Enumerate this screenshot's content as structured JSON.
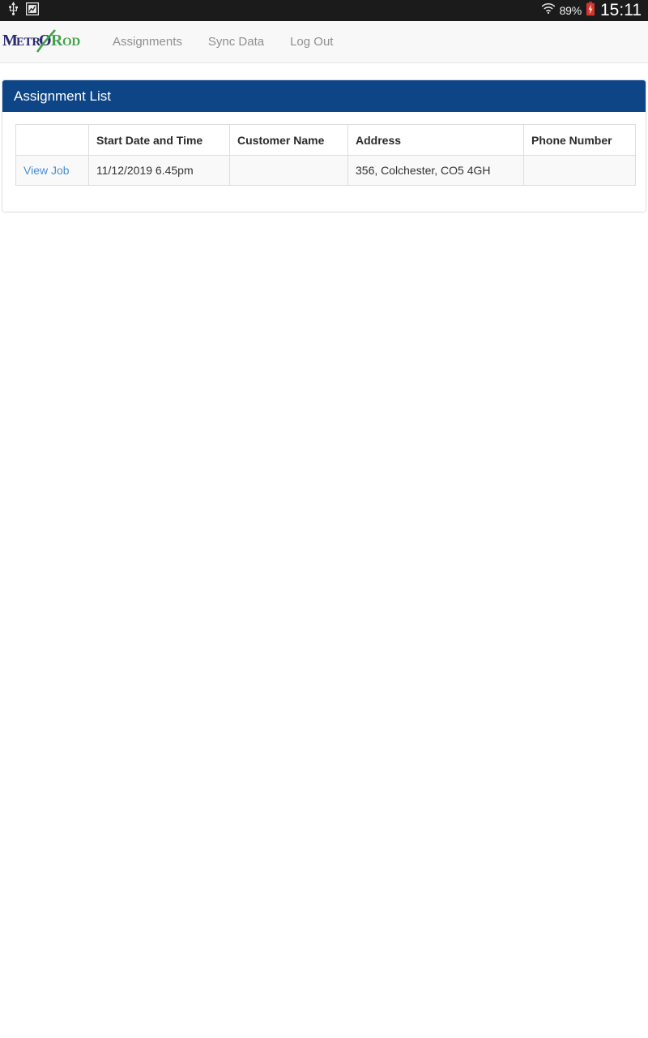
{
  "status_bar": {
    "left_icons": [
      "usb-icon",
      "screenshot-icon"
    ],
    "wifi_icon": "wifi-icon",
    "battery_percent": "89%",
    "battery_icon": "battery-charging-icon",
    "battery_color": "#d9342b",
    "time": "15:11",
    "background": "#1b1b1b"
  },
  "navbar": {
    "brand": {
      "icon": "metro-rod-logo",
      "text_part1": "METRO",
      "text_part2": "ROD",
      "color_part1": "#2b2a6e",
      "color_part2": "#3fa349"
    },
    "links": [
      {
        "label": "Assignments"
      },
      {
        "label": "Sync Data"
      },
      {
        "label": "Log Out"
      }
    ],
    "background": "#f8f8f8",
    "link_color": "#8f8f8f"
  },
  "panel": {
    "title": "Assignment List",
    "header_background": "#0e4587",
    "header_text_color": "#ffffff"
  },
  "table": {
    "columns": [
      {
        "label": ""
      },
      {
        "label": "Start Date and Time"
      },
      {
        "label": "Customer Name"
      },
      {
        "label": "Address"
      },
      {
        "label": "Phone Number"
      }
    ],
    "rows": [
      {
        "action_label": "View Job",
        "start_date_time": "11/12/2019 6.45pm",
        "customer_name": "",
        "address": "356, Colchester, CO5 4GH",
        "phone_number": ""
      }
    ],
    "link_color": "#4b8fd0",
    "row_background": "#f9f9f9",
    "border_color": "#dddddd"
  }
}
